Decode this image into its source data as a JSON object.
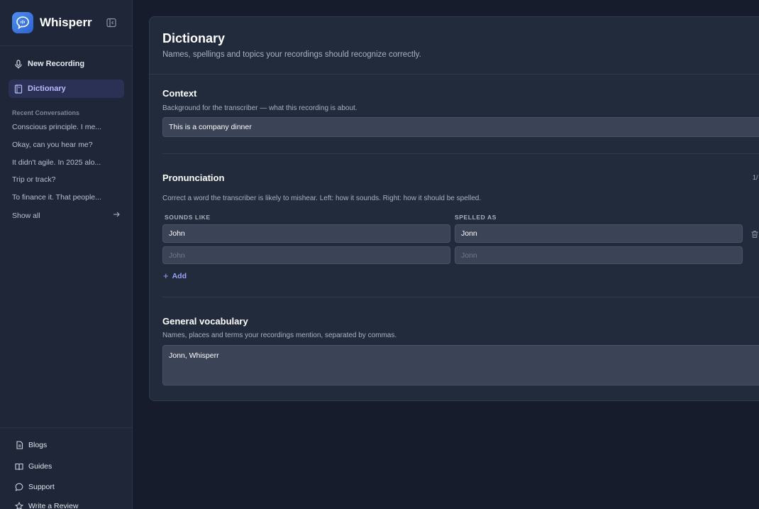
{
  "app": {
    "name": "Whisperr"
  },
  "nav": {
    "new_recording": "New Recording",
    "dictionary": "Dictionary"
  },
  "sidebar": {
    "recent_label": "Recent Conversations",
    "conversations": [
      "Conscious principle. I me...",
      "Okay, can you hear me?",
      "It didn't agile. In 2025 alo...",
      "Trip or track?",
      "To finance it. That people..."
    ],
    "show_all": "Show all",
    "footer": [
      "Blogs",
      "Guides",
      "Support",
      "Write a Review"
    ]
  },
  "page": {
    "title": "Dictionary",
    "subtitle": "Names, spellings and topics your recordings should recognize correctly."
  },
  "context": {
    "title": "Context",
    "desc": "Background for the transcriber — what this recording is about.",
    "value": "This is a company dinner"
  },
  "pronunciation": {
    "title": "Pronunciation",
    "counter": "1/",
    "desc": "Correct a word the transcriber is likely to mishear. Left: how it sounds. Right: how it should be spelled.",
    "col_sounds": "SOUNDS LIKE",
    "col_spelled": "SPELLED AS",
    "rows": [
      {
        "sounds": "John",
        "spelled": "Jonn"
      }
    ],
    "placeholder_sounds": "John",
    "placeholder_spelled": "Jonn",
    "add_label": "Add"
  },
  "vocabulary": {
    "title": "General vocabulary",
    "desc": "Names, places and terms your recordings mention, separated by commas.",
    "value": "Jonn, Whisperr"
  },
  "colors": {
    "background": "#161c2c",
    "sidebar": "#1e2637",
    "panel": "#222b3c",
    "accent": "#9aa3f8",
    "active_nav": "#2a3154"
  }
}
